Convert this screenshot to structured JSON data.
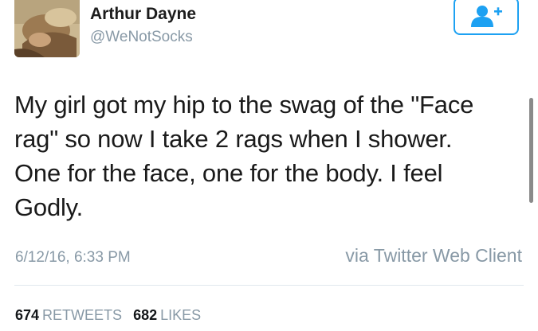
{
  "author": {
    "name": "Arthur Dayne",
    "handle": "@WeNotSocks"
  },
  "follow_button": {
    "icon": "add-user-icon",
    "color": "#1da1f2"
  },
  "tweet": {
    "lines": [
      "My girl got my hip to the swag of the \"Face",
      "rag\" so now I take 2 rags when I shower.",
      "One for the face, one for the body. I feel",
      "Godly."
    ],
    "timestamp": "6/12/16, 6:33 PM",
    "source": "via Twitter Web Client"
  },
  "stats": {
    "retweets_count": "674",
    "retweets_label": "RETWEETS",
    "likes_count": "682",
    "likes_label": "LIKES"
  }
}
